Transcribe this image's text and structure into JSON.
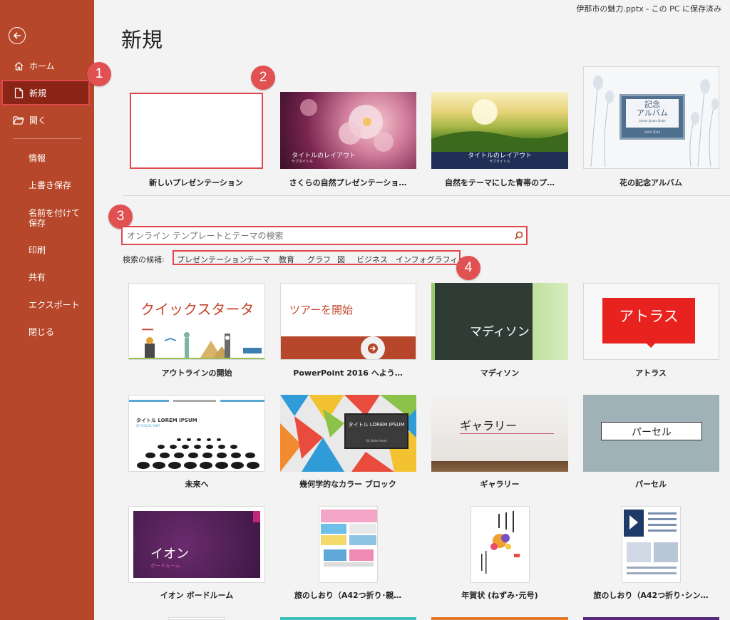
{
  "window": {
    "title": "伊那市の魅力.pptx - この PC に保存済み"
  },
  "sidebar": {
    "items": [
      {
        "label": "ホーム"
      },
      {
        "label": "新規"
      },
      {
        "label": "開く"
      }
    ],
    "subitems": [
      {
        "label": "情報"
      },
      {
        "label": "上書き保存"
      },
      {
        "label": "名前を付けて保存"
      },
      {
        "label": "印刷"
      },
      {
        "label": "共有"
      },
      {
        "label": "エクスポート"
      },
      {
        "label": "閉じる"
      }
    ]
  },
  "page": {
    "title": "新規"
  },
  "badges": [
    "1",
    "2",
    "3",
    "4"
  ],
  "featured": [
    {
      "caption": "新しいプレゼンテーション"
    },
    {
      "caption": "さくらの自然プレゼンテーショ…",
      "thumb_title": "タイトルのレイアウト",
      "thumb_sub": "サブタイトル"
    },
    {
      "caption": "自然をテーマにした青帯のプ…",
      "thumb_title": "タイトルのレイアウト",
      "thumb_sub": "サブタイトル"
    },
    {
      "caption": "花の記念アルバム",
      "thumb_title1": "記念",
      "thumb_title2": "アルバム",
      "thumb_sub": "Lorem Ipsum Dolor",
      "thumb_date": "20XX-20XX"
    }
  ],
  "search": {
    "placeholder": "オンライン テンプレートとテーマの検索"
  },
  "suggestions": {
    "label": "検索の候補:",
    "items": [
      "プレゼンテーション",
      "テーマ",
      "教育",
      "グラフ",
      "図",
      "ビジネス",
      "インフォグラフィック"
    ]
  },
  "templates": [
    {
      "caption": "アウトラインの開始",
      "thumb_text": "クイックスターター"
    },
    {
      "caption": "PowerPoint 2016 へよう…",
      "thumb_text": "ツアーを開始"
    },
    {
      "caption": "マディソン",
      "thumb_text": "マディソン"
    },
    {
      "caption": "アトラス",
      "thumb_text": "アトラス"
    },
    {
      "caption": "未来へ",
      "thumb_text": "タイトル LOREM IPSUM",
      "thumb_sub": "SIT DOLOR AMET"
    },
    {
      "caption": "幾何学的なカラー ブロック",
      "thumb_text": "タイトル LOREM IPSUM",
      "thumb_sub": "Sit Dolor Amet"
    },
    {
      "caption": "ギャラリー",
      "thumb_text": "ギャラリー"
    },
    {
      "caption": "パーセル",
      "thumb_text": "パーセル"
    },
    {
      "caption": "イオン ボードルーム",
      "thumb_text": "イオン",
      "thumb_sub": "ボードルーム"
    },
    {
      "caption": "旅のしおり（A42つ折り･親…"
    },
    {
      "caption": "年賀状 (ねずみ･元号)"
    },
    {
      "caption": "旅のしおり（A42つ折り･シン…"
    }
  ],
  "colors": {
    "accent": "#b7472a",
    "highlight": "#e0484d"
  }
}
